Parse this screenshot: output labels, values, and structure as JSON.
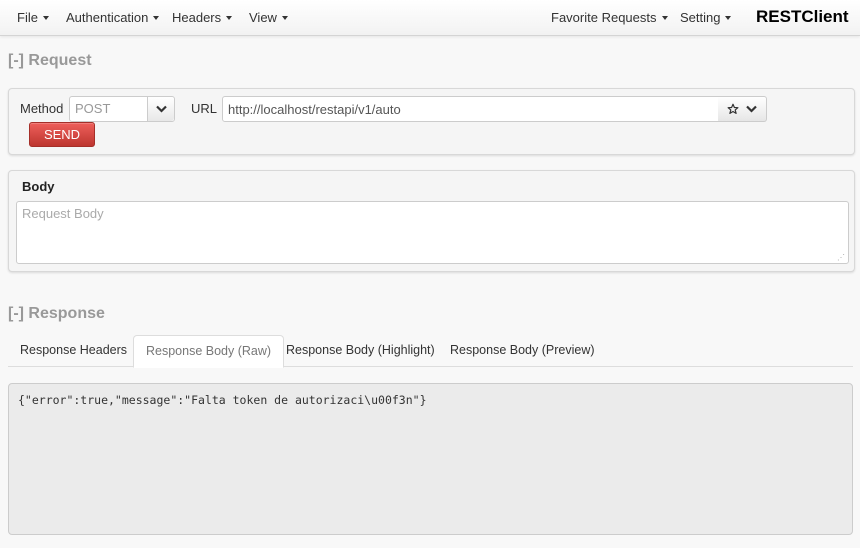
{
  "navbar": {
    "menus": [
      {
        "label": "File"
      },
      {
        "label": "Authentication"
      },
      {
        "label": "Headers"
      },
      {
        "label": "View"
      }
    ],
    "right_menus": [
      {
        "label": "Favorite Requests"
      },
      {
        "label": "Setting"
      }
    ],
    "brand": "RESTClient"
  },
  "request": {
    "section_title": "[-] Request",
    "method_label": "Method",
    "method_value": "POST",
    "url_label": "URL",
    "url_value": "http://localhost/restapi/v1/auto",
    "send_label": "SEND"
  },
  "body": {
    "heading": "Body",
    "placeholder": "Request Body",
    "value": ""
  },
  "response": {
    "section_title": "[-] Response",
    "tabs": [
      {
        "label": "Response Headers",
        "active": false
      },
      {
        "label": "Response Body (Raw)",
        "active": true
      },
      {
        "label": "Response Body (Highlight)",
        "active": false
      },
      {
        "label": "Response Body (Preview)",
        "active": false
      }
    ],
    "raw_body": "{\"error\":true,\"message\":\"Falta token de autorizaci\\u00f3n\"}"
  },
  "icons": {
    "caret": "caret-down-icon",
    "chevron": "chevron-down-icon",
    "star": "star-icon",
    "resize": "resize-grip-icon"
  },
  "colors": {
    "send_button": "#d9534f",
    "section_title": "#999999",
    "response_bg": "#ebebeb"
  }
}
